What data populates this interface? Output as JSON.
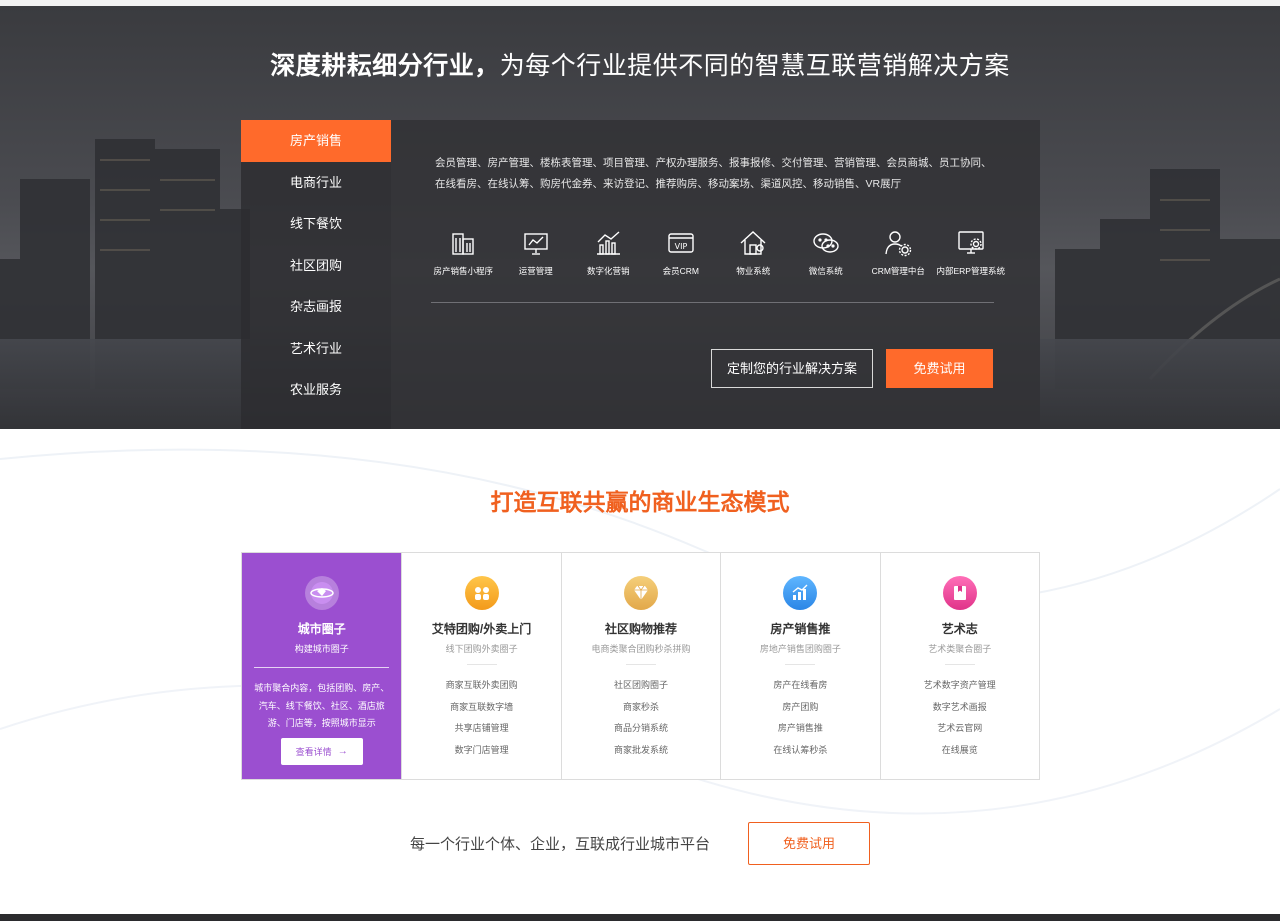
{
  "hero": {
    "title_bold": "深度耕耘细分行业，",
    "title_light": "为每个行业提供不同的智慧互联营销解决方案"
  },
  "industries": [
    {
      "label": "房产销售",
      "active": true
    },
    {
      "label": "电商行业",
      "active": false
    },
    {
      "label": "线下餐饮",
      "active": false
    },
    {
      "label": "社区团购",
      "active": false
    },
    {
      "label": "杂志画报",
      "active": false
    },
    {
      "label": "艺术行业",
      "active": false
    },
    {
      "label": "农业服务",
      "active": false
    }
  ],
  "panel": {
    "desc_line1": "会员管理、房产管理、楼栋表管理、项目管理、产权办理服务、报事报修、交付管理、营销管理、会员商城、员工协同、",
    "desc_line2": "在线看房、在线认筹、购房代金券、来访登记、推荐购房、移动案场、渠道风控、移动销售、VR展厅",
    "icons": [
      {
        "name": "building-icon",
        "label": "房产销售小程序"
      },
      {
        "name": "presentation-icon",
        "label": "运营管理"
      },
      {
        "name": "chart-icon",
        "label": "数字化营销"
      },
      {
        "name": "vip-icon",
        "label": "会员CRM"
      },
      {
        "name": "house-icon",
        "label": "物业系统"
      },
      {
        "name": "wechat-icon",
        "label": "微信系统"
      },
      {
        "name": "user-gear-icon",
        "label": "CRM管理中台"
      },
      {
        "name": "monitor-gear-icon",
        "label": "内部ERP管理系统"
      }
    ],
    "btn_custom": "定制您的行业解决方案",
    "btn_trial": "免费试用"
  },
  "section2": {
    "title": "打造互联共赢的商业生态模式",
    "featured": {
      "title": "城市圈子",
      "subtitle": "构建城市圈子",
      "desc": "城市聚合内容，包括团购、房产、汽车、线下餐饮、社区、酒店旅游、门店等，按照城市显示",
      "button": "查看详情",
      "arrow": "→"
    },
    "cards": [
      {
        "title": "艾特团购/外卖上门",
        "subtitle": "线下团购外卖圈子",
        "items": [
          "商家互联外卖团购",
          "商家互联数字墙",
          "共享店铺管理",
          "数字门店管理"
        ],
        "color": "#f6a623",
        "icon": "group-buy-icon"
      },
      {
        "title": "社区购物推荐",
        "subtitle": "电商类聚合团购秒杀拼购",
        "items": [
          "社区团购圈子",
          "商家秒杀",
          "商品分销系统",
          "商家批发系统"
        ],
        "color": "#e8b04a",
        "icon": "diamond-icon"
      },
      {
        "title": "房产销售推",
        "subtitle": "房地产销售团购圈子",
        "items": [
          "房产在线看房",
          "房产团购",
          "房产销售推",
          "在线认筹秒杀"
        ],
        "color": "#3a9ff0",
        "icon": "growth-chart-icon"
      },
      {
        "title": "艺术志",
        "subtitle": "艺术类聚合圈子",
        "items": [
          "艺术数字资产管理",
          "数字艺术画报",
          "艺术云官网",
          "在线展览"
        ],
        "color": "#ee3f9a",
        "icon": "art-book-icon"
      }
    ]
  },
  "bottom": {
    "text": "每一个行业个体、企业，互联成行业城市平台",
    "button": "免费试用"
  }
}
